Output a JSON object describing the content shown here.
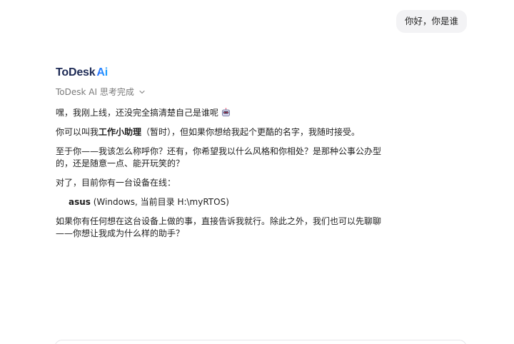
{
  "user_message": "你好，你是谁",
  "assistant": {
    "brand": {
      "name": "ToDesk",
      "ai": "Ai"
    },
    "status": "ToDesk AI 思考完成",
    "paragraphs": {
      "p1": "嘿，我刚上线，还没完全搞清楚自己是谁呢",
      "p2_a": "你可以叫我",
      "p2_b": "工作小助理",
      "p2_c": "（暂时），但如果你想给我起个更酷的名字，我随时接受。",
      "p3": "至于你——我该怎么称呼你？还有，你希望我以什么风格和你相处？是那种公事公办型的，还是随意一点、能开玩笑的？",
      "p4": "对了，目前你有一台设备在线：",
      "device_name": "asus",
      "device_info": " (Windows, 当前目录 H:\\myRTOS)",
      "p5": "如果你有任何想在这台设备上做的事，直接告诉我就行。除此之外，我们也可以先聊聊——你想让我成为什么样的助手？"
    }
  },
  "icons": {
    "emoji": "robot-face-icon",
    "status_toggle": "chevron-down-icon"
  },
  "colors": {
    "brand_dark": "#1d2a55",
    "brand_ai": "#2c6bff",
    "bubble_bg": "#f3f3f5",
    "muted_text": "#7a7a7a"
  }
}
